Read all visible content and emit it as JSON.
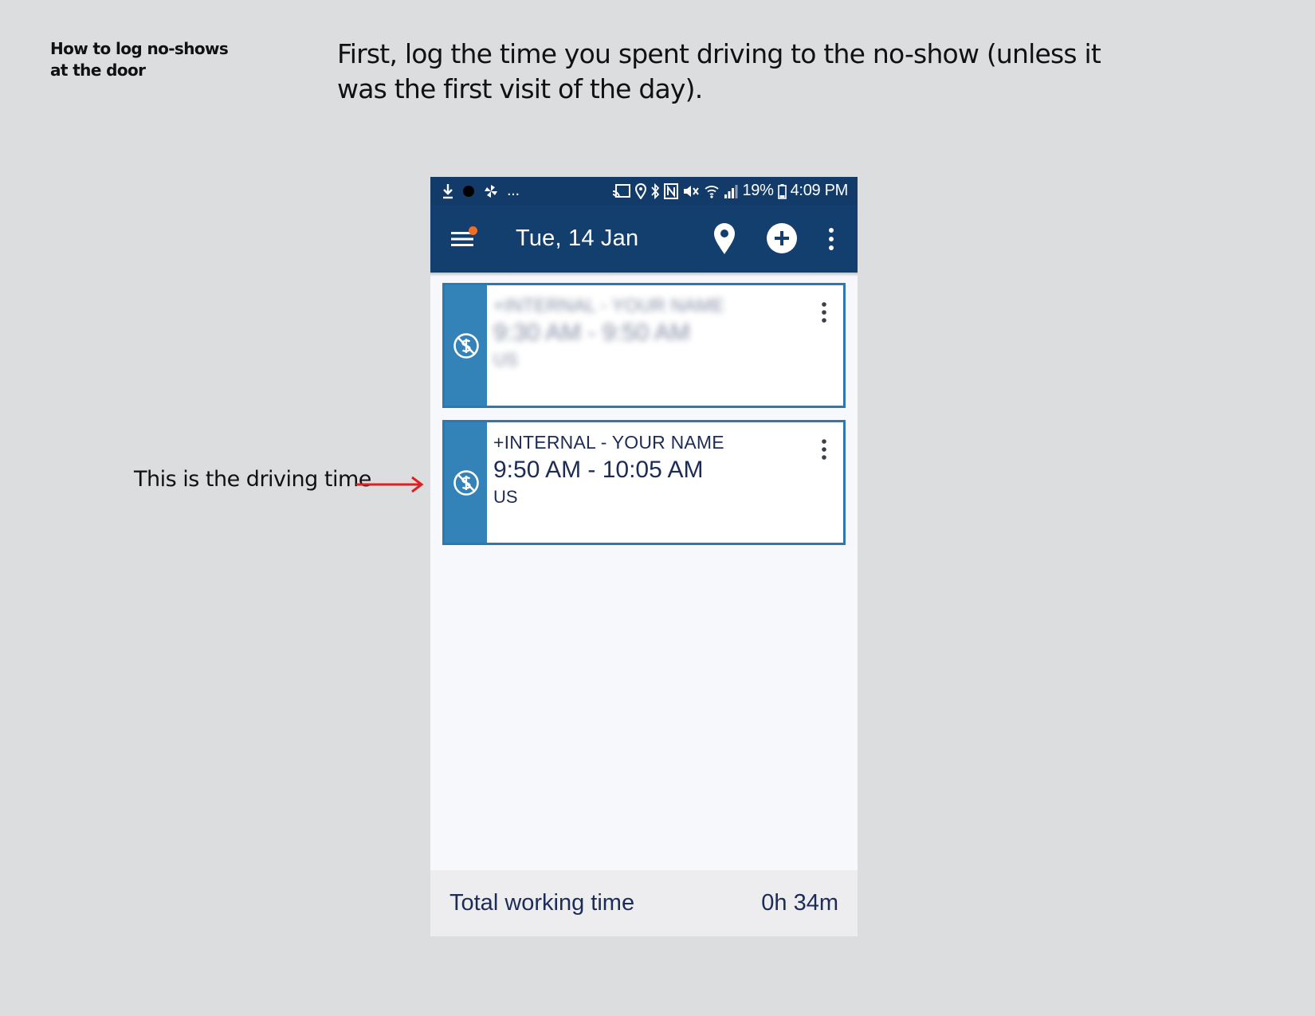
{
  "document": {
    "label_line1": "How to log no-shows",
    "label_line2": "at the door",
    "instruction": "First, log the time you spent driving to the no-show (unless it was the first visit of the day).",
    "callout": "This is the driving time",
    "arrow_color": "#e02020"
  },
  "statusbar": {
    "battery": "19%",
    "time": "4:09 PM",
    "overflow": "..."
  },
  "appbar": {
    "title": "Tue, 14 Jan",
    "notification_dot_color": "#f26d21",
    "background": "#133f6f"
  },
  "entries": [
    {
      "client": "+INTERNAL - YOUR NAME",
      "time": "9:30 AM - 9:50 AM",
      "region": "US",
      "icon": "no-billing-icon",
      "blurred": true
    },
    {
      "client": "+INTERNAL - YOUR NAME",
      "time": "9:50 AM - 10:05 AM",
      "region": "US",
      "icon": "no-billing-icon",
      "blurred": false
    }
  ],
  "footer": {
    "label": "Total working time",
    "value": "0h 34m"
  },
  "colors": {
    "card_accent": "#3383b8",
    "card_border": "#2f78ad",
    "text_dark": "#1d2c57"
  }
}
